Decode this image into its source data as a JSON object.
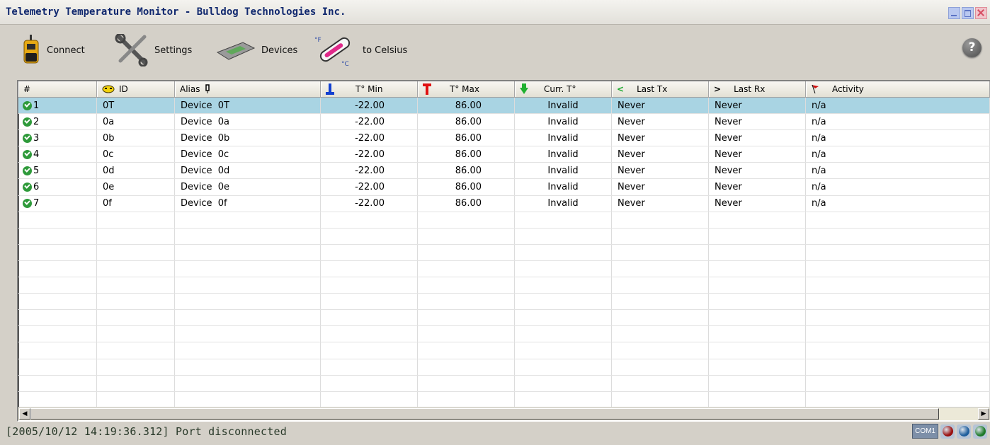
{
  "window": {
    "title": "Telemetry Temperature Monitor - Bulldog Technologies Inc."
  },
  "toolbar": {
    "connect_label": "Connect",
    "settings_label": "Settings",
    "devices_label": "Devices",
    "celsius_label": "to Celsius",
    "thermo_f": "°F",
    "thermo_c": "°C",
    "help_label": "?"
  },
  "columns": [
    "#",
    "ID",
    "Alias",
    "T° Min",
    "T° Max",
    "Curr. T°",
    "Last Tx",
    "Last Rx",
    "Activity"
  ],
  "rows": [
    {
      "num": "1",
      "id": "0T",
      "alias": "Device  0T",
      "tmin": "-22.00",
      "tmax": "86.00",
      "curr": "Invalid",
      "last_tx": "Never",
      "last_rx": "Never",
      "activity": "n/a"
    },
    {
      "num": "2",
      "id": "0a",
      "alias": "Device  0a",
      "tmin": "-22.00",
      "tmax": "86.00",
      "curr": "Invalid",
      "last_tx": "Never",
      "last_rx": "Never",
      "activity": "n/a"
    },
    {
      "num": "3",
      "id": "0b",
      "alias": "Device  0b",
      "tmin": "-22.00",
      "tmax": "86.00",
      "curr": "Invalid",
      "last_tx": "Never",
      "last_rx": "Never",
      "activity": "n/a"
    },
    {
      "num": "4",
      "id": "0c",
      "alias": "Device  0c",
      "tmin": "-22.00",
      "tmax": "86.00",
      "curr": "Invalid",
      "last_tx": "Never",
      "last_rx": "Never",
      "activity": "n/a"
    },
    {
      "num": "5",
      "id": "0d",
      "alias": "Device  0d",
      "tmin": "-22.00",
      "tmax": "86.00",
      "curr": "Invalid",
      "last_tx": "Never",
      "last_rx": "Never",
      "activity": "n/a"
    },
    {
      "num": "6",
      "id": "0e",
      "alias": "Device  0e",
      "tmin": "-22.00",
      "tmax": "86.00",
      "curr": "Invalid",
      "last_tx": "Never",
      "last_rx": "Never",
      "activity": "n/a"
    },
    {
      "num": "7",
      "id": "0f",
      "alias": "Device  0f",
      "tmin": "-22.00",
      "tmax": "86.00",
      "curr": "Invalid",
      "last_tx": "Never",
      "last_rx": "Never",
      "activity": "n/a"
    }
  ],
  "selected_row": 0,
  "status": {
    "message": "[2005/10/12 14:19:36.312] Port disconnected",
    "port": "COM1",
    "led_colors": [
      "#9a1010",
      "#1f5e9c",
      "#1e7a2a"
    ]
  },
  "icons": [
    "walkie-talkie-icon",
    "tools-icon",
    "device-icon",
    "thermometer-icon",
    "help-icon",
    "check-icon",
    "smiley-icon",
    "pin-icon",
    "thermo-min-icon",
    "thermo-max-icon",
    "current-temp-icon",
    "last-tx-icon",
    "last-rx-icon",
    "flag-icon"
  ]
}
